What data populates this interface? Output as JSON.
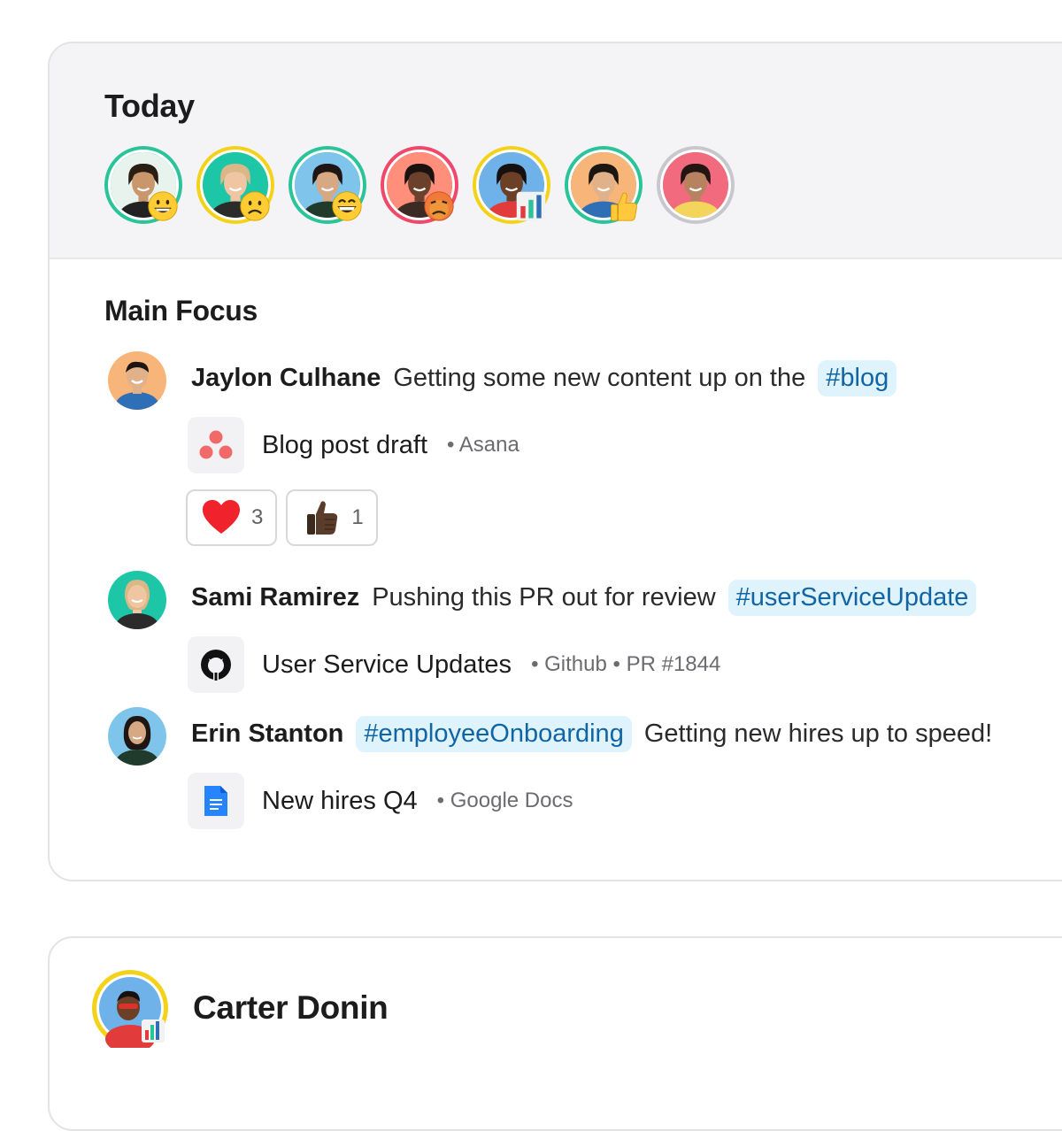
{
  "today": {
    "title": "Today",
    "avatars": [
      {
        "name": "person-1",
        "ring": "#2bc49a",
        "bg": "#e9f3ee",
        "skin": "#c9976b",
        "hair": "#2a1d14",
        "shirt": "#222222",
        "status": "grinning-emoji"
      },
      {
        "name": "person-2",
        "ring": "#f4d21a",
        "bg": "#1ec6a8",
        "skin": "#f0c6a2",
        "hair": "#d9b787",
        "shirt": "#2b2b2b",
        "status": "frowning-emoji"
      },
      {
        "name": "person-3",
        "ring": "#2bc49a",
        "bg": "#7fc4ea",
        "skin": "#d6a884",
        "hair": "#1f1613",
        "shirt": "#203a2c",
        "status": "grinning-smiling-eyes-emoji"
      },
      {
        "name": "person-4",
        "ring": "#f0476a",
        "bg": "#ff8f7a",
        "skin": "#6b412c",
        "hair": "#1b1210",
        "shirt": "#3c2a24",
        "status": "sick-emoji"
      },
      {
        "name": "person-5",
        "ring": "#f4d21a",
        "bg": "#6fb2ea",
        "skin": "#6c3f27",
        "hair": "#161010",
        "shirt": "#e23b3b",
        "status": "bar-chart-emoji"
      },
      {
        "name": "person-6",
        "ring": "#2bc49a",
        "bg": "#f7b57a",
        "skin": "#e1b18a",
        "hair": "#1c1612",
        "shirt": "#2f6fb6",
        "status": "thumbs-up-emoji"
      },
      {
        "name": "person-7",
        "ring": "#c8c8cc",
        "bg": "#f26a7e",
        "skin": "#b7825f",
        "hair": "#231612",
        "shirt": "#f2d55a",
        "status": ""
      }
    ]
  },
  "main_focus": {
    "title": "Main Focus",
    "entries": [
      {
        "name": "Jaylon Culhane",
        "text": "Getting some new content up on the",
        "hashtag": "#blog",
        "attachment": {
          "title": "Blog post draft",
          "meta": "• Asana",
          "icon": "asana-icon"
        },
        "reactions": [
          {
            "emoji": "heart-emoji",
            "count": "3"
          },
          {
            "emoji": "thumbs-up-emoji",
            "count": "1"
          }
        ]
      },
      {
        "name": "Sami Ramirez",
        "text": "Pushing this PR out for review",
        "hashtag": "#userServiceUpdate",
        "attachment": {
          "title": "User Service Updates",
          "meta": "• Github • PR #1844",
          "icon": "github-icon"
        }
      },
      {
        "name": "Erin Stanton",
        "hashtag": "#employeeOnboarding",
        "text": "Getting new hires up to speed!",
        "attachment": {
          "title": "New hires Q4",
          "meta": "• Google Docs",
          "icon": "google-docs-icon"
        }
      }
    ]
  },
  "next_card": {
    "name": "Carter Donin",
    "ring": "#f4d21a",
    "status": "bar-chart-emoji"
  },
  "colors": {
    "hashtag_bg": "#def3fc",
    "hashtag_text": "#1264a3",
    "header_bg": "#f4f4f6"
  }
}
